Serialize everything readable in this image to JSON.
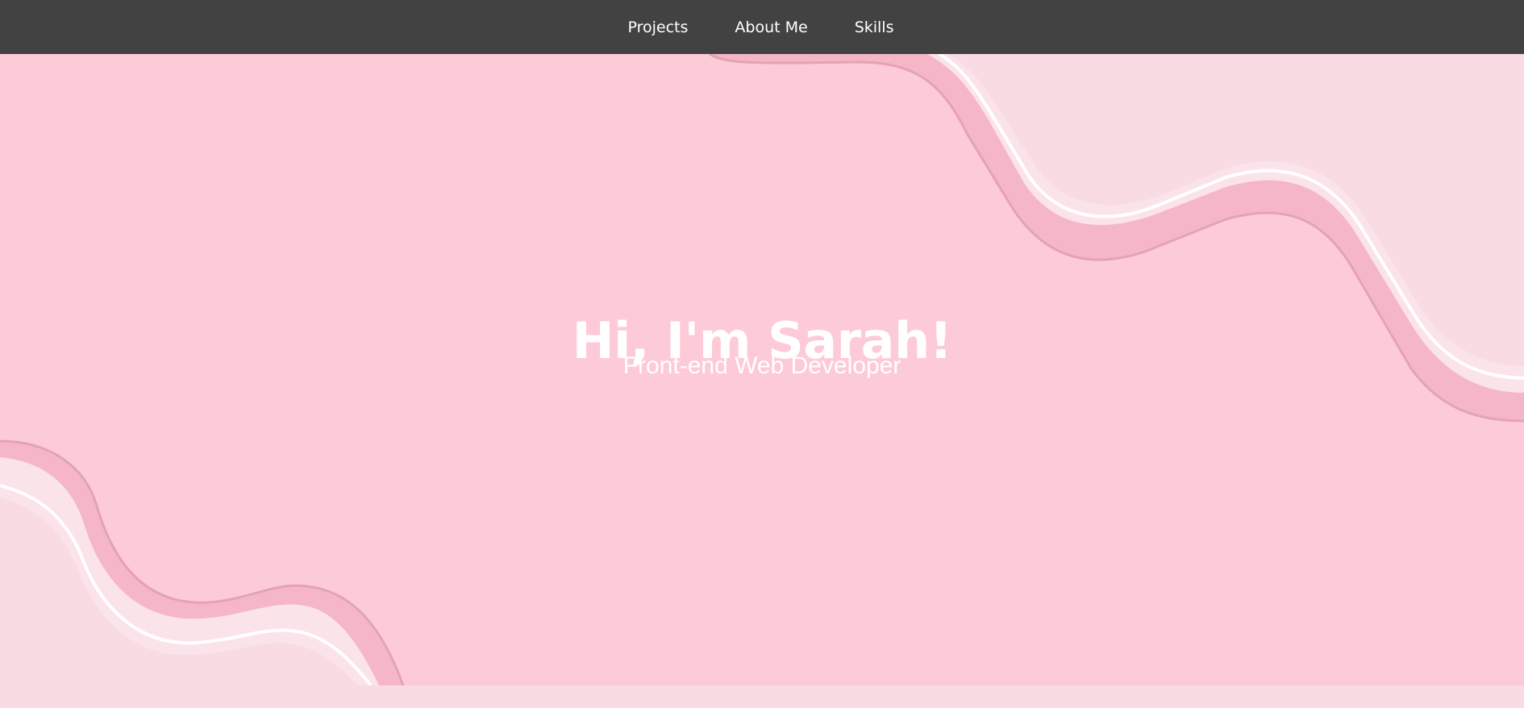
{
  "nav": {
    "items": [
      {
        "label": "Projects"
      },
      {
        "label": "About Me"
      },
      {
        "label": "Skills"
      }
    ]
  },
  "hero": {
    "title": "Hi, I'm Sarah!",
    "subtitle": "Front-end Web Developer"
  },
  "colors": {
    "navbar": "#424242",
    "hero_background": "#fdcbd7",
    "wave_light": "#f9dbe4",
    "wave_outline": "#e3a3b4",
    "text": "#ffffff"
  }
}
